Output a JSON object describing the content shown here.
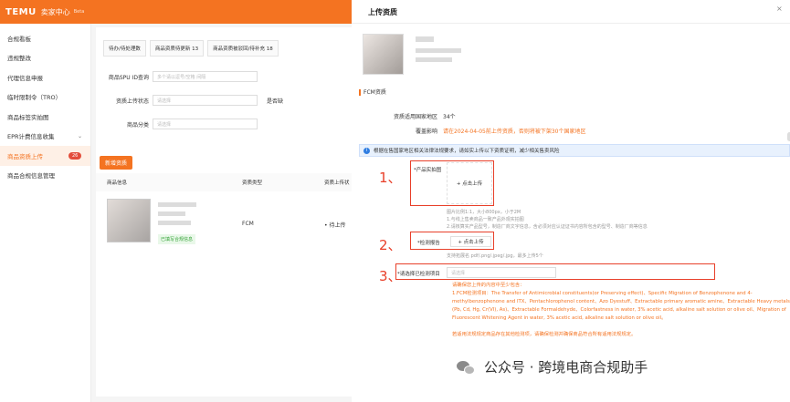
{
  "app": {
    "logo": "TEMU",
    "title": "卖家中心",
    "beta": "Beta"
  },
  "sidebar": {
    "items": [
      {
        "label": "合规看板"
      },
      {
        "label": "违规整改"
      },
      {
        "label": "代理信息申报"
      },
      {
        "label": "临时限制令（TRO）"
      },
      {
        "label": "商品标签实拍图"
      },
      {
        "label": "EPR计费信息收集"
      },
      {
        "label": "商品资质上传",
        "badge": "26"
      },
      {
        "label": "商品合规信息管理"
      }
    ]
  },
  "main": {
    "tabs": [
      {
        "label": "待办/待处理数"
      },
      {
        "label": "商品资质待更新 13"
      },
      {
        "label": "商品资质被驳回/待补充 18"
      }
    ],
    "filters": [
      {
        "label": "商品SPU ID查询",
        "placeholder": "多个请以逗号/空格 间隔"
      },
      {
        "label": "资质上传状态",
        "placeholder": "请选择"
      },
      {
        "label": "商品分类",
        "placeholder": "请选择"
      }
    ],
    "filter_extra": "是否缺",
    "add_button": "新增资质",
    "table": {
      "headers": [
        "商品信息",
        "资质类型",
        "资质上传状"
      ],
      "row": {
        "tag": "已填写合规信息",
        "type": "FCM",
        "status": "• 待上传"
      }
    }
  },
  "modal": {
    "title": "上传资质",
    "close": "×",
    "section": "FCM资质",
    "kv": [
      {
        "k": "资质适用国家地区",
        "v": "34个"
      },
      {
        "k": "覆盖影响",
        "v": "请在2024-04-05前上传资质，否则将被下架30个国家地区"
      }
    ],
    "info": "根据在售国家地区相关法律法规要求，请如实上传以下资质证明，减少相关售卖风险",
    "numbers": [
      "1、",
      "2、",
      "3、"
    ],
    "product_photo_label": "*产品实拍图",
    "upload_label": "+ 点击上传",
    "photo_hints": [
      "图片比例1:1，大小800px，小于2M",
      "1.与线上售卖商品一致产品外观实拍图",
      "2.请核算实产品型号，制造厂商文字信息，含必须对应认证证书内容所包含的型号、制造厂商等信息"
    ],
    "report_label": "*检测报告",
    "report_hint": "支持拓展名 pdf/.png/.jpeg/.jpg，最多上传5个",
    "date_label": "*请选择已检测项目",
    "date_placeholder": "请选择",
    "req_title": "请确保您上传的内容中至少包含：",
    "req_body": "1.FCM检测项目：The Transfer of Antimicrobial constituents(or Preserving effect)、Specific Migration of Benzophenone and 4-methylbenzophenone and ITX、Pentachlorophenol content、Azo Dyestuff、Extractable primary aromatic amine、Extractable Heavy metals (Pb, Cd, Hg, Cr(VI), As)、Extractable Formaldehyde、Colorfastness in water, 3% acetic acid, alkaline salt solution or olive oil、Migration of Fluorescent Whitening Agent in water, 3% acetic acid, alkaline salt solution or olive oil。",
    "req_note": "若适用法规规定商品存在其他检测项，请确保检测并确保商品符合所有适用法规规定。"
  },
  "watermark": {
    "text": "公众号 · 跨境电商合规助手"
  },
  "colors": {
    "brand": "#f47321",
    "alert": "#e8402a",
    "info": "#2f7de1"
  }
}
